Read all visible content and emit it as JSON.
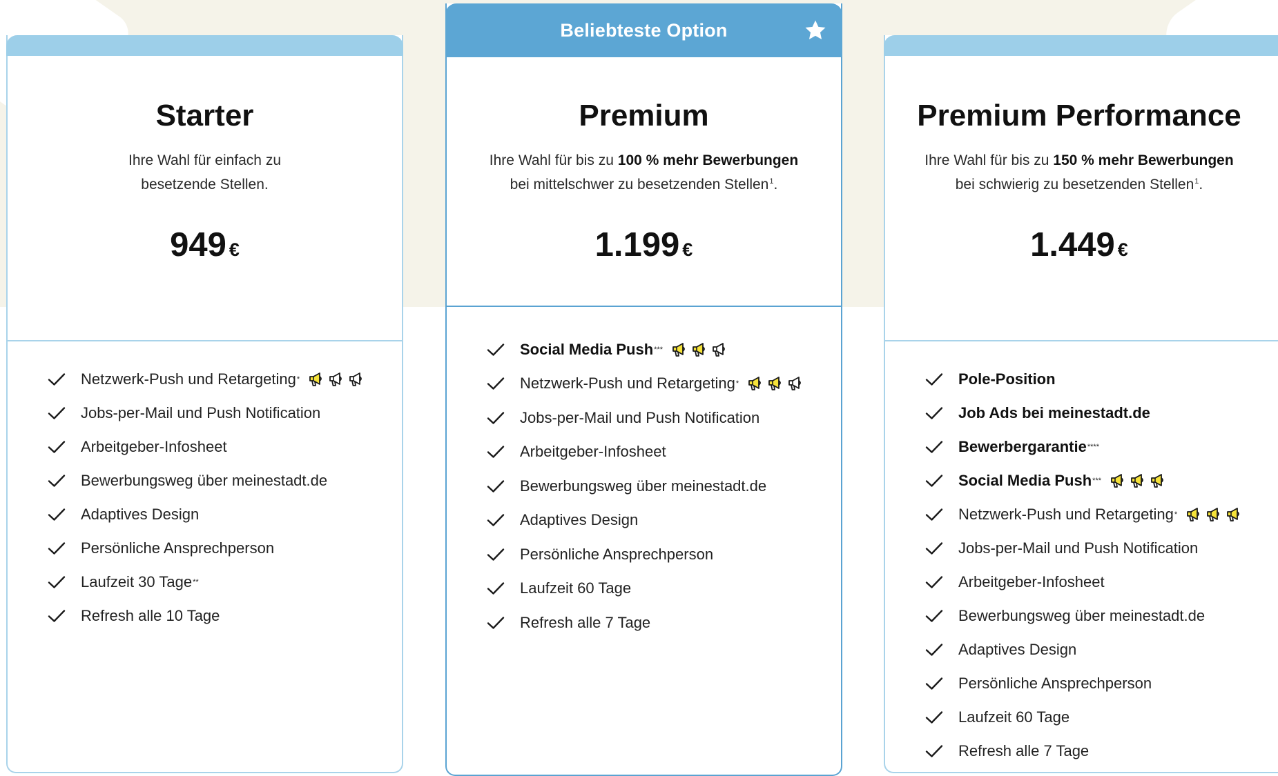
{
  "colors": {
    "accent": "#5ca6d4",
    "border": "#a9d3ea",
    "megaphone_fill": "#f6e33a"
  },
  "plans": [
    {
      "name": "Starter",
      "desc_line1": "Ihre Wahl für einfach zu",
      "desc_line2": "besetzende Stellen.",
      "price": "949",
      "currency": "€",
      "features": [
        {
          "label": "Netzwerk-Push und Retargeting",
          "sup": "*",
          "megaphones_filled": 1
        },
        {
          "label": "Jobs-per-Mail und Push Notification"
        },
        {
          "label": "Arbeitgeber-Infosheet"
        },
        {
          "label": "Bewerbungsweg über meinestadt.de"
        },
        {
          "label": "Adaptives Design"
        },
        {
          "label": "Persönliche Ansprechperson"
        },
        {
          "label": "Laufzeit 30 Tage",
          "sup": "**"
        },
        {
          "label": "Refresh alle 10 Tage"
        }
      ]
    },
    {
      "name": "Premium",
      "badge": "Beliebteste Option",
      "desc_pre": "Ihre Wahl für bis zu ",
      "desc_bold": "100 % mehr Bewerbungen",
      "desc_line2": "bei mittelschwer zu besetzenden Stellen",
      "desc_sup": "1",
      "desc_end": ".",
      "price": "1.199",
      "currency": "€",
      "features": [
        {
          "label": "Social Media Push",
          "sup": "***",
          "bold": true,
          "megaphones_filled": 2
        },
        {
          "label": "Netzwerk-Push und Retargeting",
          "sup": "*",
          "megaphones_filled": 2
        },
        {
          "label": "Jobs-per-Mail und Push Notification"
        },
        {
          "label": "Arbeitgeber-Infosheet"
        },
        {
          "label": "Bewerbungsweg über meinestadt.de"
        },
        {
          "label": "Adaptives Design"
        },
        {
          "label": "Persönliche Ansprechperson"
        },
        {
          "label": "Laufzeit 60 Tage"
        },
        {
          "label": "Refresh alle 7 Tage"
        }
      ]
    },
    {
      "name": "Premium Performance",
      "desc_pre": "Ihre Wahl für bis zu ",
      "desc_bold": "150 % mehr Bewerbungen",
      "desc_line2": "bei schwierig zu besetzenden Stellen",
      "desc_sup": "1",
      "desc_end": ".",
      "price": "1.449",
      "currency": "€",
      "features": [
        {
          "label": "Pole-Position",
          "bold": true
        },
        {
          "label": "Job Ads bei meinestadt.de",
          "bold": true
        },
        {
          "label": "Bewerbergarantie",
          "sup": "****",
          "bold": true
        },
        {
          "label": "Social Media Push",
          "sup": "***",
          "bold": true,
          "megaphones_filled": 3
        },
        {
          "label": "Netzwerk-Push und Retargeting",
          "sup": "*",
          "megaphones_filled": 3
        },
        {
          "label": "Jobs-per-Mail und Push Notification"
        },
        {
          "label": "Arbeitgeber-Infosheet"
        },
        {
          "label": "Bewerbungsweg über meinestadt.de"
        },
        {
          "label": "Adaptives Design"
        },
        {
          "label": "Persönliche Ansprechperson"
        },
        {
          "label": "Laufzeit 60 Tage"
        },
        {
          "label": "Refresh alle 7 Tage"
        }
      ]
    }
  ]
}
